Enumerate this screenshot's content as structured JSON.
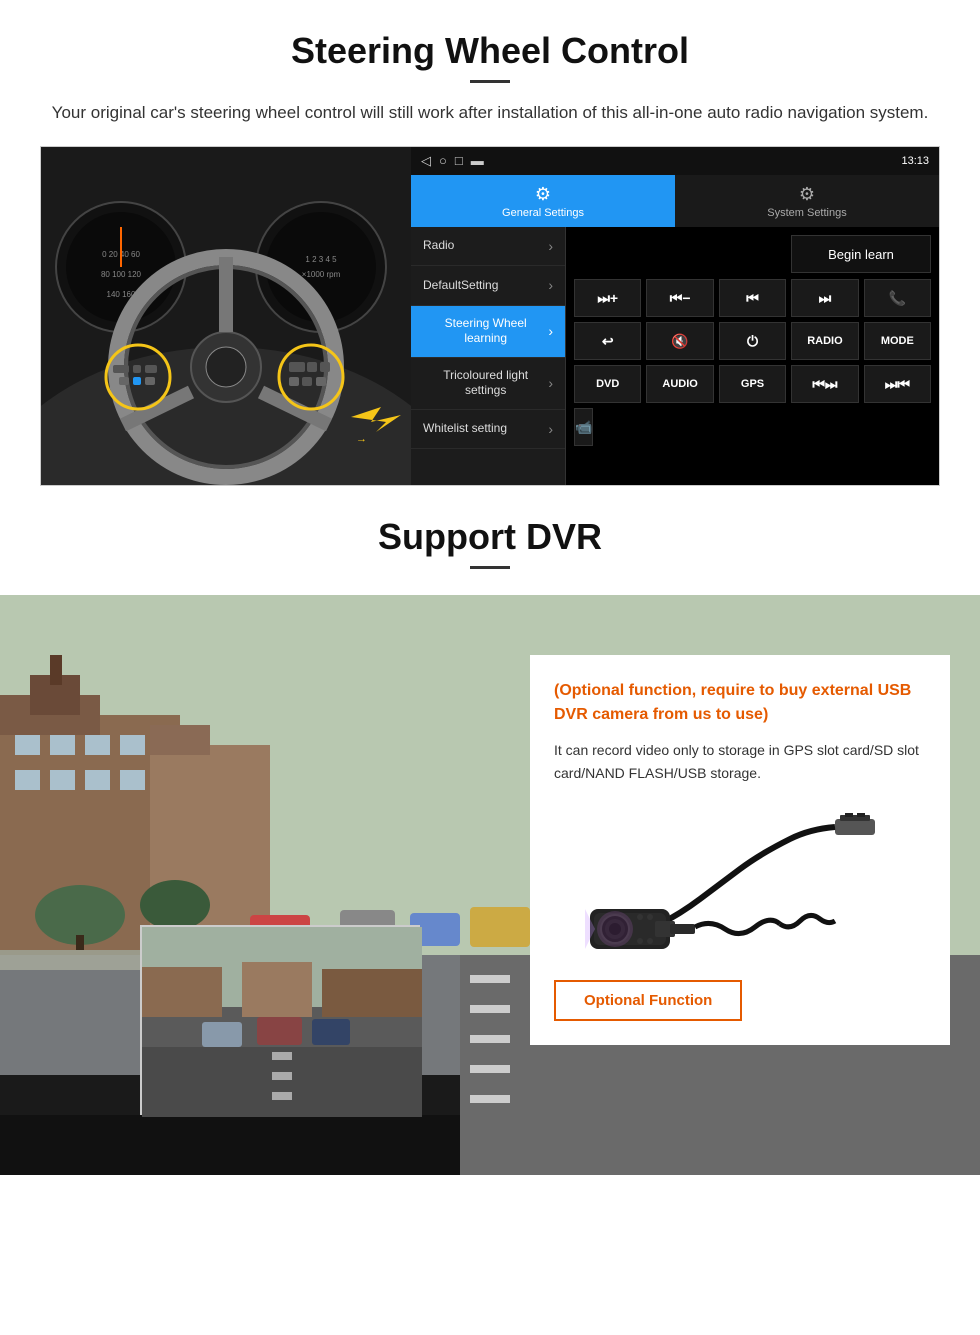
{
  "steering": {
    "title": "Steering Wheel Control",
    "subtitle": "Your original car's steering wheel control will still work after installation of this all-in-one auto radio navigation system.",
    "statusbar": {
      "time": "13:13",
      "icons": "◁  ○  □  ▬"
    },
    "tabs": {
      "general": "General Settings",
      "system": "System Settings"
    },
    "menu_items": [
      {
        "label": "Radio",
        "active": false
      },
      {
        "label": "DefaultSetting",
        "active": false
      },
      {
        "label": "Steering Wheel learning",
        "active": true
      },
      {
        "label": "Tricoloured light settings",
        "active": false
      },
      {
        "label": "Whitelist setting",
        "active": false
      }
    ],
    "begin_learn": "Begin learn",
    "control_buttons": [
      [
        "⏭+",
        "⏮−",
        "⏮⏮",
        "⏭⏭",
        "☎"
      ],
      [
        "↩",
        "🔇×",
        "⏻",
        "RADIO",
        "MODE"
      ],
      [
        "DVD",
        "AUDIO",
        "GPS",
        "⏮⏮",
        "⏭⏭"
      ],
      [
        "📽"
      ]
    ]
  },
  "dvr": {
    "title": "Support DVR",
    "optional_text": "(Optional function, require to buy external USB DVR camera from us to use)",
    "description": "It can record video only to storage in GPS slot card/SD slot card/NAND FLASH/USB storage.",
    "optional_button": "Optional Function"
  }
}
